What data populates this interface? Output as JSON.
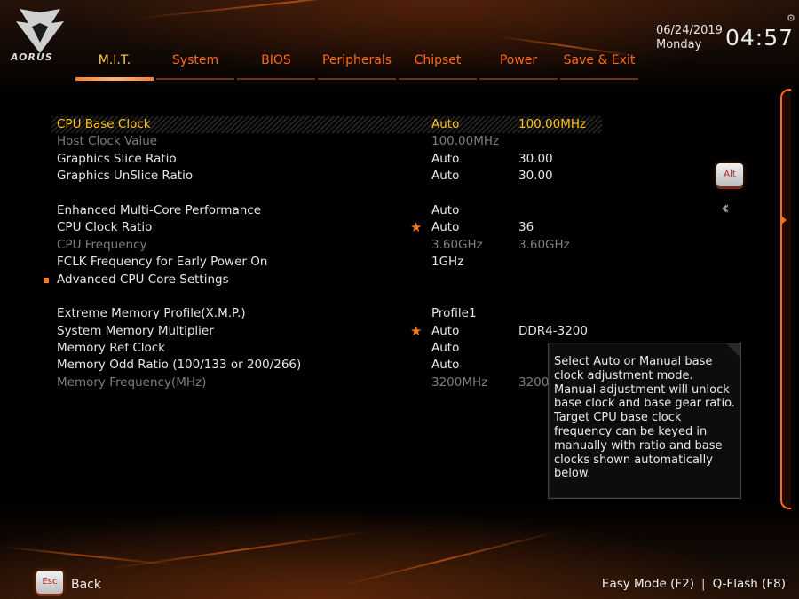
{
  "brand": {
    "logo_text": "AORUS"
  },
  "datetime": {
    "date": "06/24/2019",
    "day": "Monday",
    "time": "04:57"
  },
  "tabs": [
    {
      "label": "M.I.T.",
      "active": true
    },
    {
      "label": "System"
    },
    {
      "label": "BIOS"
    },
    {
      "label": "Peripherals"
    },
    {
      "label": "Chipset"
    },
    {
      "label": "Power"
    },
    {
      "label": "Save & Exit"
    }
  ],
  "settings": {
    "cpu_base_clock": {
      "label": "CPU Base Clock",
      "value1": "Auto",
      "value2": "100.00MHz"
    },
    "host_clock_value": {
      "label": "Host Clock Value",
      "value1": "100.00MHz"
    },
    "graphics_slice_ratio": {
      "label": "Graphics Slice Ratio",
      "value1": "Auto",
      "value2": "30.00"
    },
    "graphics_unslice_ratio": {
      "label": "Graphics UnSlice Ratio",
      "value1": "Auto",
      "value2": "30.00"
    },
    "enhanced_multicore": {
      "label": "Enhanced Multi-Core Performance",
      "value1": "Auto"
    },
    "cpu_clock_ratio": {
      "label": "CPU Clock Ratio",
      "value1": "Auto",
      "value2": "36"
    },
    "cpu_frequency": {
      "label": "CPU Frequency",
      "value1": "3.60GHz",
      "value2": "3.60GHz"
    },
    "fclk_frequency": {
      "label": "FCLK Frequency for Early Power On",
      "value1": "1GHz"
    },
    "advanced_cpu_core": {
      "label": "Advanced CPU Core Settings"
    },
    "xmp": {
      "label": "Extreme Memory Profile(X.M.P.)",
      "value1": "Profile1"
    },
    "system_memory_multiplier": {
      "label": "System Memory Multiplier",
      "value1": "Auto",
      "value2": "DDR4-3200"
    },
    "memory_ref_clock": {
      "label": "Memory Ref Clock",
      "value1": "Auto"
    },
    "memory_odd_ratio": {
      "label": "Memory Odd Ratio (100/133 or 200/266)",
      "value1": "Auto"
    },
    "memory_frequency": {
      "label": "Memory Frequency(MHz)",
      "value1": "3200MHz",
      "value2": "3200"
    }
  },
  "help": {
    "text": "Select Auto or Manual base clock adjustment mode. Manual adjustment will unlock base clock and base gear ratio.\nTarget CPU base clock frequency can be keyed in manually with ratio and base clocks shown automatically below."
  },
  "keys": {
    "alt": "Alt",
    "esc": "Esc"
  },
  "footer": {
    "back": "Back",
    "easy_mode": "Easy Mode (F2)",
    "separator": "|",
    "qflash": "Q-Flash (F8)"
  },
  "colors": {
    "accent": "#ff6a1a",
    "selected": "#ffc21a",
    "dim": "#7d7d7d"
  }
}
